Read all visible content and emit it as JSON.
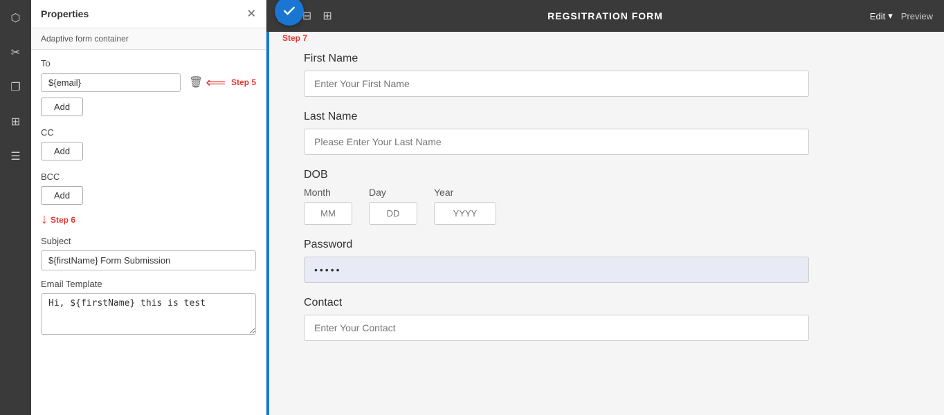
{
  "iconBar": {
    "icons": [
      "⬡",
      "✂",
      "❏",
      "⊞",
      "☰"
    ]
  },
  "propertiesPanel": {
    "title": "Properties",
    "subtitle": "Adaptive form container",
    "closeIcon": "✕",
    "to": {
      "label": "To",
      "emailValue": "${email}",
      "addLabel": "Add"
    },
    "cc": {
      "label": "CC",
      "addLabel": "Add"
    },
    "bcc": {
      "label": "BCC",
      "addLabel": "Add"
    },
    "subject": {
      "label": "Subject",
      "value": "${firstName} Form Submission"
    },
    "emailTemplate": {
      "label": "Email Template",
      "value": "Hi, ${firstName} this is test"
    },
    "steps": {
      "step5": "Step 5",
      "step6": "Step 6",
      "step7": "Step 7"
    }
  },
  "toolbar": {
    "title": "REGSITRATION FORM",
    "editLabel": "Edit",
    "previewLabel": "Preview",
    "chevronDown": "▾"
  },
  "form": {
    "firstName": {
      "label": "First Name",
      "placeholder": "Enter Your First Name"
    },
    "lastName": {
      "label": "Last Name",
      "placeholder": "Please Enter Your Last Name"
    },
    "dob": {
      "label": "DOB",
      "month": {
        "label": "Month",
        "placeholder": "MM"
      },
      "day": {
        "label": "Day",
        "placeholder": "DD"
      },
      "year": {
        "label": "Year",
        "placeholder": "YYYY"
      }
    },
    "password": {
      "label": "Password",
      "value": "•••••"
    },
    "contact": {
      "label": "Contact",
      "placeholder": "Enter Your Contact"
    }
  }
}
